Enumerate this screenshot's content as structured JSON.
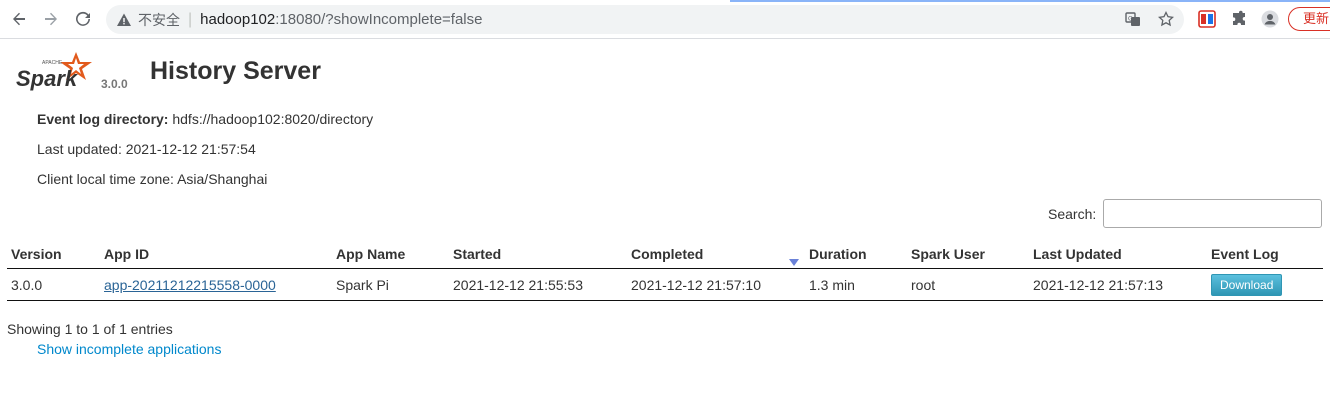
{
  "browser": {
    "insecure_label": "不安全",
    "url_host": "hadoop102",
    "url_path": ":18080/?showIncomplete=false",
    "update_label": "更新",
    "accent": "#d93025"
  },
  "header": {
    "logo_text": "Spark",
    "logo_apache": "APACHE",
    "version": "3.0.0",
    "title": "History Server"
  },
  "info": {
    "event_log_label": "Event log directory:",
    "event_log_value": "hdfs://hadoop102:8020/directory",
    "last_updated": "Last updated: 2021-12-12 21:57:54",
    "timezone": "Client local time zone: Asia/Shanghai"
  },
  "search": {
    "label": "Search:",
    "value": ""
  },
  "table": {
    "columns": [
      "Version",
      "App ID",
      "App Name",
      "Started",
      "Completed",
      "Duration",
      "Spark User",
      "Last Updated",
      "Event Log"
    ],
    "sorted_column": "Completed",
    "rows": [
      {
        "version": "3.0.0",
        "app_id": "app-20211212215558-0000",
        "app_name": "Spark Pi",
        "started": "2021-12-12 21:55:53",
        "completed": "2021-12-12 21:57:10",
        "duration": "1.3 min",
        "user": "root",
        "last_updated": "2021-12-12 21:57:13",
        "event_log": "Download"
      }
    ]
  },
  "footer": {
    "entries": "Showing 1 to 1 of 1 entries",
    "incomplete_link": "Show incomplete applications"
  }
}
